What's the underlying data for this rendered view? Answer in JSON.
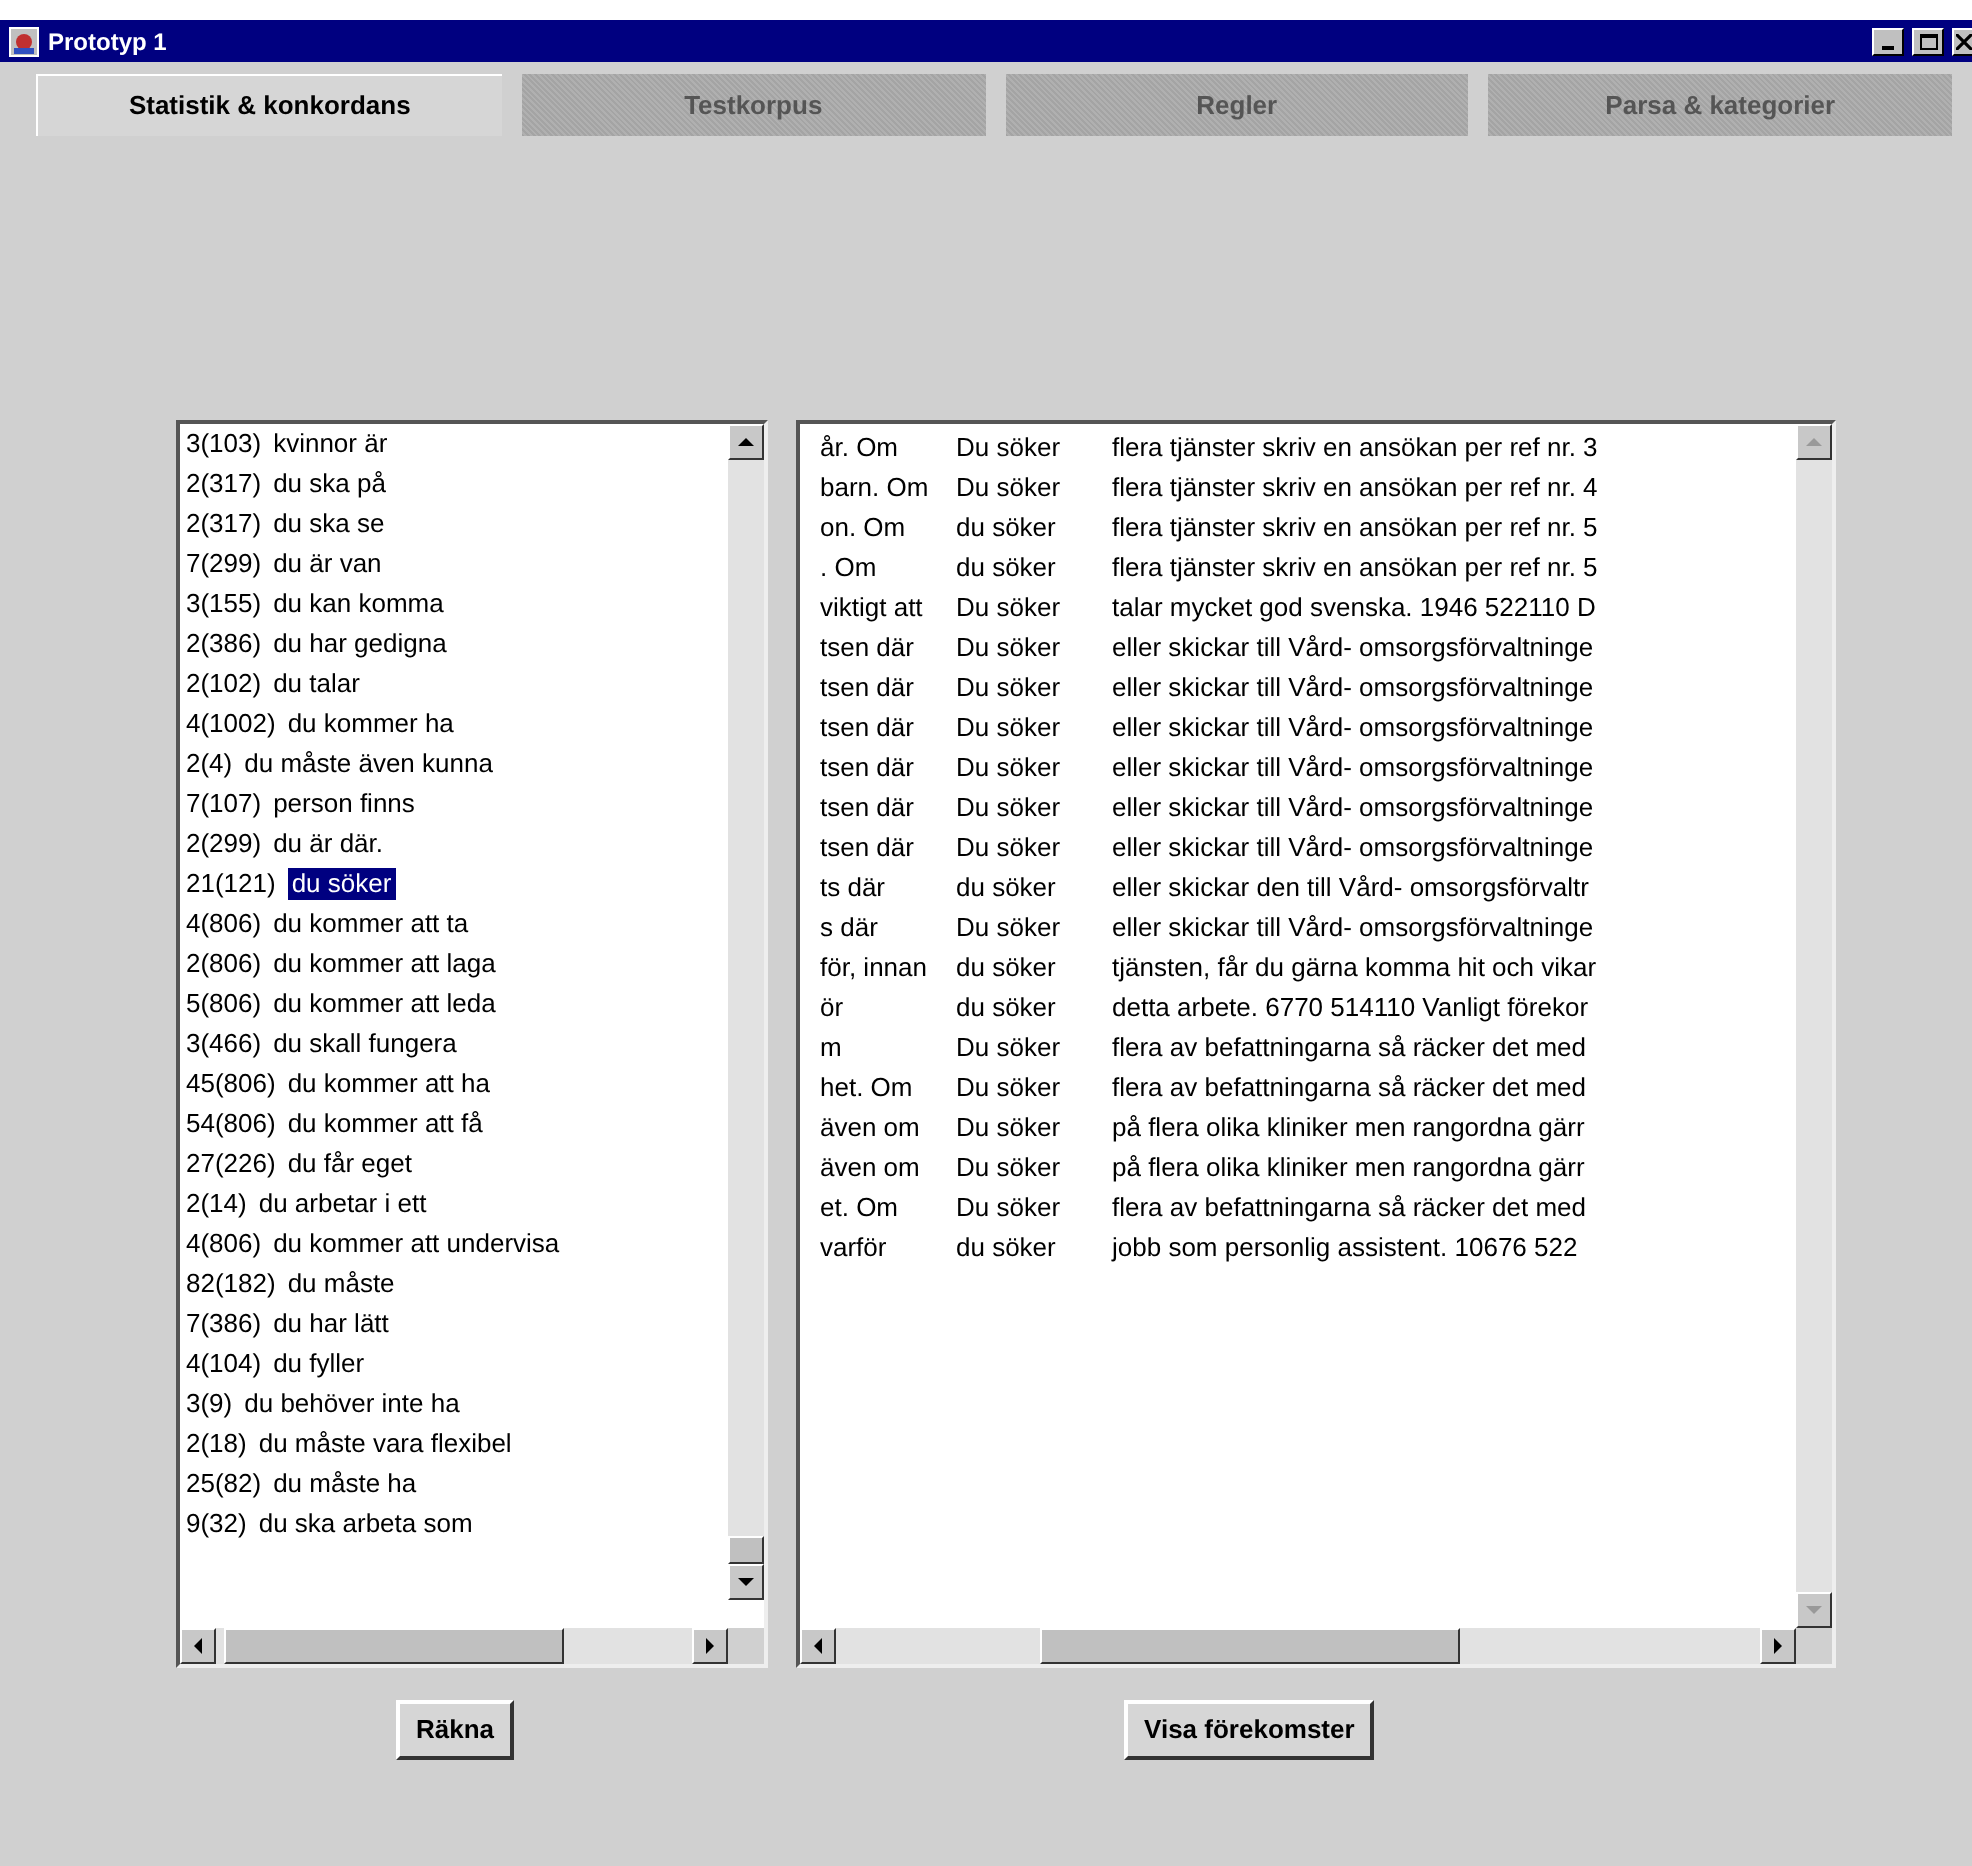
{
  "window": {
    "title": "Prototyp 1"
  },
  "tabs": [
    {
      "label": "Statistik & konkordans",
      "selected": true
    },
    {
      "label": "Testkorpus",
      "selected": false
    },
    {
      "label": "Regler",
      "selected": false
    },
    {
      "label": "Parsa & kategorier",
      "selected": false
    }
  ],
  "phrase_list": [
    {
      "count": "3(103)",
      "phrase": "kvinnor är",
      "selected": false
    },
    {
      "count": "2(317)",
      "phrase": "du ska på",
      "selected": false
    },
    {
      "count": "2(317)",
      "phrase": "du ska se",
      "selected": false
    },
    {
      "count": "7(299)",
      "phrase": "du är van",
      "selected": false
    },
    {
      "count": "3(155)",
      "phrase": "du kan komma",
      "selected": false
    },
    {
      "count": "2(386)",
      "phrase": "du har gedigna",
      "selected": false
    },
    {
      "count": "2(102)",
      "phrase": "du talar",
      "selected": false
    },
    {
      "count": "4(1002)",
      "phrase": "du kommer ha",
      "selected": false
    },
    {
      "count": "2(4)",
      "phrase": "du måste även kunna",
      "selected": false
    },
    {
      "count": "7(107)",
      "phrase": "person finns",
      "selected": false
    },
    {
      "count": "2(299)",
      "phrase": "du är där.",
      "selected": false
    },
    {
      "count": "21(121)",
      "phrase": "du söker",
      "selected": true
    },
    {
      "count": "4(806)",
      "phrase": "du kommer att ta",
      "selected": false
    },
    {
      "count": "2(806)",
      "phrase": "du kommer att laga",
      "selected": false
    },
    {
      "count": "5(806)",
      "phrase": "du kommer att leda",
      "selected": false
    },
    {
      "count": "3(466)",
      "phrase": "du skall fungera",
      "selected": false
    },
    {
      "count": "45(806)",
      "phrase": "du kommer att ha",
      "selected": false
    },
    {
      "count": "54(806)",
      "phrase": "du kommer att få",
      "selected": false
    },
    {
      "count": "27(226)",
      "phrase": "du får eget",
      "selected": false
    },
    {
      "count": "2(14)",
      "phrase": "du arbetar i ett",
      "selected": false
    },
    {
      "count": "4(806)",
      "phrase": "du kommer att undervisa",
      "selected": false
    },
    {
      "count": "82(182)",
      "phrase": "du måste",
      "selected": false
    },
    {
      "count": "7(386)",
      "phrase": "du har lätt",
      "selected": false
    },
    {
      "count": "4(104)",
      "phrase": "du fyller",
      "selected": false
    },
    {
      "count": "3(9)",
      "phrase": "du behöver inte ha",
      "selected": false
    },
    {
      "count": "2(18)",
      "phrase": "du måste vara flexibel",
      "selected": false
    },
    {
      "count": "25(82)",
      "phrase": "du måste ha",
      "selected": false
    },
    {
      "count": "9(32)",
      "phrase": "du ska arbeta som",
      "selected": false
    }
  ],
  "concordance": [
    {
      "left": "år. Om",
      "keyword": "Du söker",
      "right": "flera tjänster skriv en ansökan per ref nr. 3"
    },
    {
      "left": "barn. Om",
      "keyword": "Du söker",
      "right": "flera tjänster skriv en ansökan per ref nr. 4"
    },
    {
      "left": "on. Om",
      "keyword": "du söker",
      "right": "flera tjänster skriv en ansökan per ref nr. 5"
    },
    {
      "left": ". Om",
      "keyword": "du söker",
      "right": "flera tjänster skriv en ansökan per ref nr. 5"
    },
    {
      "left": "viktigt att",
      "keyword": "Du söker",
      "right": "talar mycket god svenska. 1946 522110 D"
    },
    {
      "left": "tsen där",
      "keyword": "Du söker",
      "right": "eller skickar till Vård- omsorgsförvaltninge"
    },
    {
      "left": "tsen där",
      "keyword": "Du söker",
      "right": "eller skickar till Vård- omsorgsförvaltninge"
    },
    {
      "left": "tsen där",
      "keyword": "Du söker",
      "right": "eller skickar till Vård- omsorgsförvaltninge"
    },
    {
      "left": "tsen där",
      "keyword": "Du söker",
      "right": "eller skickar till Vård- omsorgsförvaltninge"
    },
    {
      "left": "tsen där",
      "keyword": "Du söker",
      "right": "eller skickar till Vård- omsorgsförvaltninge"
    },
    {
      "left": "tsen där",
      "keyword": "Du söker",
      "right": "eller skickar till Vård- omsorgsförvaltninge"
    },
    {
      "left": "ts där",
      "keyword": "du söker",
      "right": "eller skickar den till Vård- omsorgsförvaltr"
    },
    {
      "left": "s där",
      "keyword": "Du söker",
      "right": "eller skickar till Vård- omsorgsförvaltninge"
    },
    {
      "left": "för, innan",
      "keyword": "du söker",
      "right": "tjänsten, får du gärna komma hit och vikar"
    },
    {
      "left": "ör",
      "keyword": "du söker",
      "right": "detta arbete. 6770 514110 Vanligt förekor"
    },
    {
      "left": "m",
      "keyword": "Du söker",
      "right": "flera av befattningarna så räcker det med"
    },
    {
      "left": "het. Om",
      "keyword": "Du söker",
      "right": "flera av befattningarna så räcker det med"
    },
    {
      "left": "även om",
      "keyword": "Du söker",
      "right": "på flera olika kliniker men rangordna gärr"
    },
    {
      "left": "även om",
      "keyword": "Du söker",
      "right": "på flera olika kliniker men rangordna gärr"
    },
    {
      "left": "et. Om",
      "keyword": "Du söker",
      "right": "flera av befattningarna så räcker det med"
    },
    {
      "left": "varför",
      "keyword": "du söker",
      "right": "jobb som personlig assistent. 10676 522"
    }
  ],
  "buttons": {
    "count": "Räkna",
    "show": "Visa förekomster"
  }
}
